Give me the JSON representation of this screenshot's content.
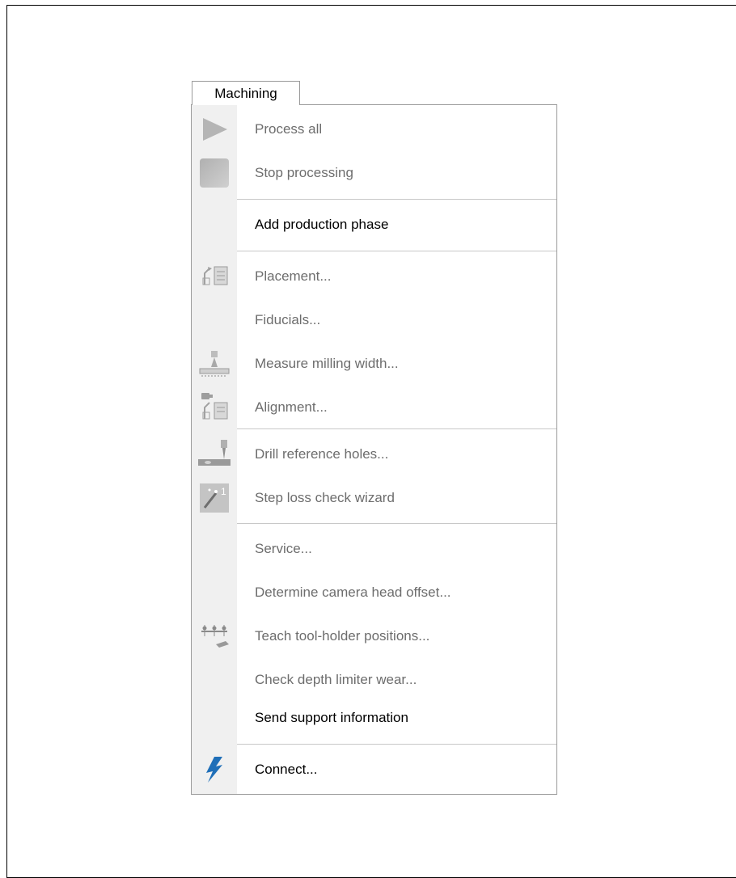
{
  "menu": {
    "tab_label": "Machining",
    "items": [
      {
        "label": "Process all",
        "enabled": false,
        "icon": "play-icon"
      },
      {
        "label": "Stop processing",
        "enabled": false,
        "icon": "stop-icon"
      },
      {
        "label": "Add production phase",
        "enabled": true,
        "icon": ""
      },
      {
        "label": "Placement...",
        "enabled": false,
        "icon": "placement-icon"
      },
      {
        "label": "Fiducials...",
        "enabled": false,
        "icon": ""
      },
      {
        "label": "Measure milling width...",
        "enabled": false,
        "icon": "measure-milling-width-icon"
      },
      {
        "label": "Alignment...",
        "enabled": false,
        "icon": "alignment-icon"
      },
      {
        "label": "Drill reference holes...",
        "enabled": false,
        "icon": "drill-icon"
      },
      {
        "label": "Step loss check wizard",
        "enabled": false,
        "icon": "wizard-icon"
      },
      {
        "label": "Service...",
        "enabled": false,
        "icon": ""
      },
      {
        "label": "Determine camera head offset...",
        "enabled": false,
        "icon": ""
      },
      {
        "label": "Teach tool-holder positions...",
        "enabled": false,
        "icon": "teach-tool-holder-icon"
      },
      {
        "label": "Check depth limiter wear...",
        "enabled": false,
        "icon": ""
      },
      {
        "label": "Send support information",
        "enabled": true,
        "icon": ""
      },
      {
        "label": "Connect...",
        "enabled": true,
        "icon": "lightning-icon"
      }
    ]
  }
}
